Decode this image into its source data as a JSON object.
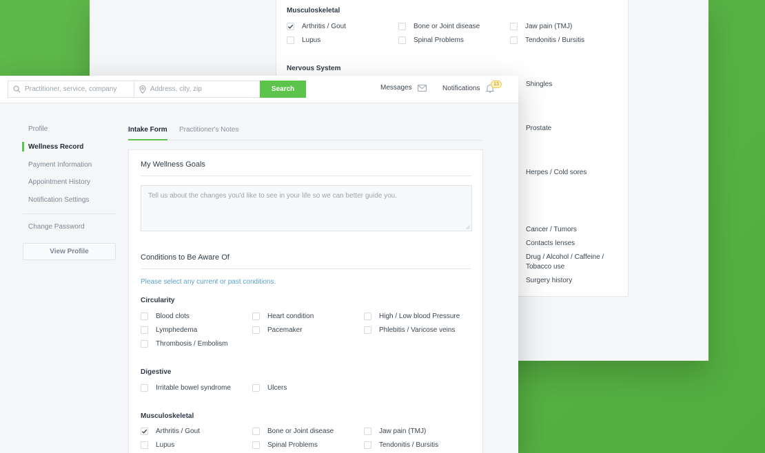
{
  "back": {
    "musculoskeletal_title": "Musculoskeletal",
    "musculoskeletal": [
      {
        "label": "Arthritis / Gout",
        "checked": true
      },
      {
        "label": "Bone or Joint disease",
        "checked": false
      },
      {
        "label": "Jaw pain (TMJ)",
        "checked": false
      },
      {
        "label": "Lupus",
        "checked": false
      },
      {
        "label": "Spinal Problems",
        "checked": false
      },
      {
        "label": "Tendonitis / Bursitis",
        "checked": false
      }
    ],
    "nervous_title": "Nervous System",
    "right_column": [
      {
        "label": "Shingles"
      },
      {
        "label": "Prostate"
      },
      {
        "label": "Herpes / Cold sores"
      },
      {
        "label": "Cancer / Tumors"
      },
      {
        "label": "Contacts lenses"
      },
      {
        "label": "Drug / Alcohol / Caffeine / Tobacco use"
      },
      {
        "label": "Surgery history"
      }
    ]
  },
  "header": {
    "search_placeholder": "Practitioner, service, company",
    "location_placeholder": "Address, city, zip",
    "search_label": "Search",
    "messages_label": "Messages",
    "notifications_label": "Notifications",
    "notifications_count": "13"
  },
  "sidebar": {
    "items": [
      {
        "label": "Profile"
      },
      {
        "label": "Wellness Record"
      },
      {
        "label": "Payment Information"
      },
      {
        "label": "Appointment History"
      },
      {
        "label": "Notification Settings"
      },
      {
        "label": "Change Password"
      }
    ],
    "view_profile_label": "View Profile"
  },
  "tabs": [
    {
      "label": "Intake Form"
    },
    {
      "label": "Practitioner's Notes"
    }
  ],
  "form": {
    "goals_title": "My Wellness Goals",
    "goals_placeholder": "Tell us about the changes you'd like to see in your life so we can better guide you.",
    "conditions_title": "Conditions to Be Aware Of",
    "conditions_hint": "Please select any current or past conditions.",
    "groups": [
      {
        "title": "Circularity",
        "items": [
          {
            "label": "Blood clots",
            "checked": false
          },
          {
            "label": "Heart condition",
            "checked": false
          },
          {
            "label": "High / Low blood Pressure",
            "checked": false
          },
          {
            "label": "Lymphedema",
            "checked": false
          },
          {
            "label": "Pacemaker",
            "checked": false
          },
          {
            "label": "Phlebitis / Varicose veins",
            "checked": false
          },
          {
            "label": "Thrombosis / Embolism",
            "checked": false
          }
        ]
      },
      {
        "title": "Digestive",
        "items": [
          {
            "label": "Irritable bowel syndrome",
            "checked": false
          },
          {
            "label": "Ulcers",
            "checked": false
          }
        ]
      },
      {
        "title": "Musculoskeletal",
        "items": [
          {
            "label": "Arthritis / Gout",
            "checked": true
          },
          {
            "label": "Bone or Joint disease",
            "checked": false
          },
          {
            "label": "Jaw pain (TMJ)",
            "checked": false
          },
          {
            "label": "Lupus",
            "checked": false
          },
          {
            "label": "Spinal Problems",
            "checked": false
          },
          {
            "label": "Tendonitis / Bursitis",
            "checked": false
          }
        ]
      }
    ]
  },
  "colors": {
    "background": "#5fb84a",
    "accent": "#5cc34b",
    "hint": "#5aa0c8"
  }
}
